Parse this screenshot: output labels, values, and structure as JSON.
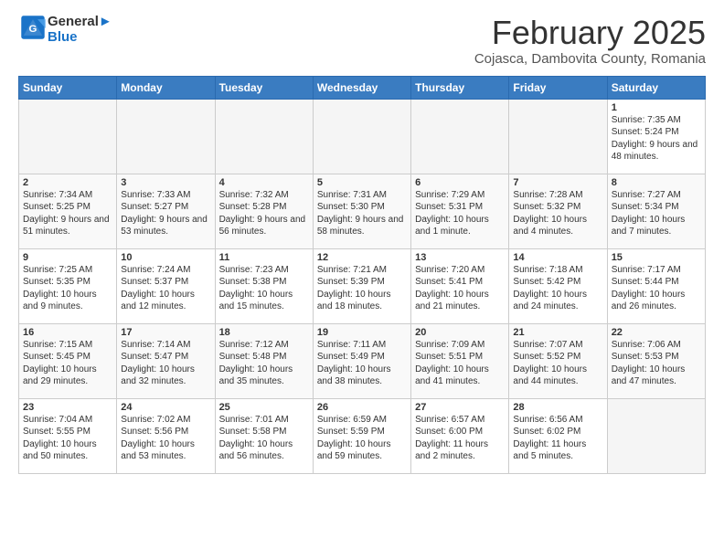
{
  "header": {
    "logo_line1": "General",
    "logo_line2": "Blue",
    "title": "February 2025",
    "subtitle": "Cojasca, Dambovita County, Romania"
  },
  "days_of_week": [
    "Sunday",
    "Monday",
    "Tuesday",
    "Wednesday",
    "Thursday",
    "Friday",
    "Saturday"
  ],
  "weeks": [
    [
      {
        "num": "",
        "info": ""
      },
      {
        "num": "",
        "info": ""
      },
      {
        "num": "",
        "info": ""
      },
      {
        "num": "",
        "info": ""
      },
      {
        "num": "",
        "info": ""
      },
      {
        "num": "",
        "info": ""
      },
      {
        "num": "1",
        "info": "Sunrise: 7:35 AM\nSunset: 5:24 PM\nDaylight: 9 hours and 48 minutes."
      }
    ],
    [
      {
        "num": "2",
        "info": "Sunrise: 7:34 AM\nSunset: 5:25 PM\nDaylight: 9 hours and 51 minutes."
      },
      {
        "num": "3",
        "info": "Sunrise: 7:33 AM\nSunset: 5:27 PM\nDaylight: 9 hours and 53 minutes."
      },
      {
        "num": "4",
        "info": "Sunrise: 7:32 AM\nSunset: 5:28 PM\nDaylight: 9 hours and 56 minutes."
      },
      {
        "num": "5",
        "info": "Sunrise: 7:31 AM\nSunset: 5:30 PM\nDaylight: 9 hours and 58 minutes."
      },
      {
        "num": "6",
        "info": "Sunrise: 7:29 AM\nSunset: 5:31 PM\nDaylight: 10 hours and 1 minute."
      },
      {
        "num": "7",
        "info": "Sunrise: 7:28 AM\nSunset: 5:32 PM\nDaylight: 10 hours and 4 minutes."
      },
      {
        "num": "8",
        "info": "Sunrise: 7:27 AM\nSunset: 5:34 PM\nDaylight: 10 hours and 7 minutes."
      }
    ],
    [
      {
        "num": "9",
        "info": "Sunrise: 7:25 AM\nSunset: 5:35 PM\nDaylight: 10 hours and 9 minutes."
      },
      {
        "num": "10",
        "info": "Sunrise: 7:24 AM\nSunset: 5:37 PM\nDaylight: 10 hours and 12 minutes."
      },
      {
        "num": "11",
        "info": "Sunrise: 7:23 AM\nSunset: 5:38 PM\nDaylight: 10 hours and 15 minutes."
      },
      {
        "num": "12",
        "info": "Sunrise: 7:21 AM\nSunset: 5:39 PM\nDaylight: 10 hours and 18 minutes."
      },
      {
        "num": "13",
        "info": "Sunrise: 7:20 AM\nSunset: 5:41 PM\nDaylight: 10 hours and 21 minutes."
      },
      {
        "num": "14",
        "info": "Sunrise: 7:18 AM\nSunset: 5:42 PM\nDaylight: 10 hours and 24 minutes."
      },
      {
        "num": "15",
        "info": "Sunrise: 7:17 AM\nSunset: 5:44 PM\nDaylight: 10 hours and 26 minutes."
      }
    ],
    [
      {
        "num": "16",
        "info": "Sunrise: 7:15 AM\nSunset: 5:45 PM\nDaylight: 10 hours and 29 minutes."
      },
      {
        "num": "17",
        "info": "Sunrise: 7:14 AM\nSunset: 5:47 PM\nDaylight: 10 hours and 32 minutes."
      },
      {
        "num": "18",
        "info": "Sunrise: 7:12 AM\nSunset: 5:48 PM\nDaylight: 10 hours and 35 minutes."
      },
      {
        "num": "19",
        "info": "Sunrise: 7:11 AM\nSunset: 5:49 PM\nDaylight: 10 hours and 38 minutes."
      },
      {
        "num": "20",
        "info": "Sunrise: 7:09 AM\nSunset: 5:51 PM\nDaylight: 10 hours and 41 minutes."
      },
      {
        "num": "21",
        "info": "Sunrise: 7:07 AM\nSunset: 5:52 PM\nDaylight: 10 hours and 44 minutes."
      },
      {
        "num": "22",
        "info": "Sunrise: 7:06 AM\nSunset: 5:53 PM\nDaylight: 10 hours and 47 minutes."
      }
    ],
    [
      {
        "num": "23",
        "info": "Sunrise: 7:04 AM\nSunset: 5:55 PM\nDaylight: 10 hours and 50 minutes."
      },
      {
        "num": "24",
        "info": "Sunrise: 7:02 AM\nSunset: 5:56 PM\nDaylight: 10 hours and 53 minutes."
      },
      {
        "num": "25",
        "info": "Sunrise: 7:01 AM\nSunset: 5:58 PM\nDaylight: 10 hours and 56 minutes."
      },
      {
        "num": "26",
        "info": "Sunrise: 6:59 AM\nSunset: 5:59 PM\nDaylight: 10 hours and 59 minutes."
      },
      {
        "num": "27",
        "info": "Sunrise: 6:57 AM\nSunset: 6:00 PM\nDaylight: 11 hours and 2 minutes."
      },
      {
        "num": "28",
        "info": "Sunrise: 6:56 AM\nSunset: 6:02 PM\nDaylight: 11 hours and 5 minutes."
      },
      {
        "num": "",
        "info": ""
      }
    ]
  ]
}
